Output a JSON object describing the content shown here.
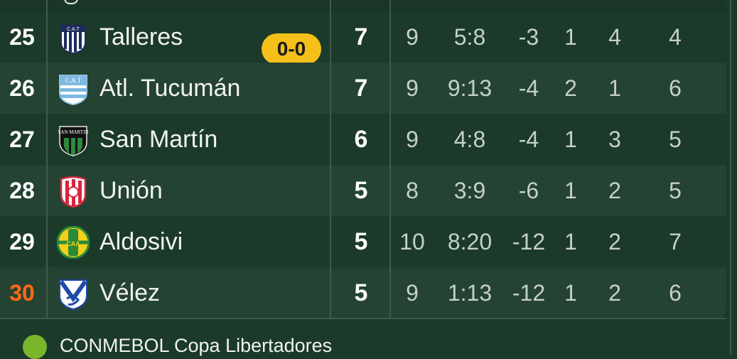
{
  "rows": [
    {
      "pos": "25",
      "team": "Talleres",
      "pts": "7",
      "played": "9",
      "goals": "5:8",
      "diff": "-3",
      "w": "1",
      "d": "4",
      "l": "4",
      "logo": "talleres-crest-icon"
    },
    {
      "pos": "26",
      "team": "Atl. Tucumán",
      "pts": "7",
      "played": "9",
      "goals": "9:13",
      "diff": "-4",
      "w": "2",
      "d": "1",
      "l": "6",
      "logo": "atletico-tucuman-crest-icon"
    },
    {
      "pos": "27",
      "team": "San Martín",
      "pts": "6",
      "played": "9",
      "goals": "4:8",
      "diff": "-4",
      "w": "1",
      "d": "3",
      "l": "5",
      "logo": "san-martin-crest-icon"
    },
    {
      "pos": "28",
      "team": "Unión",
      "pts": "5",
      "played": "8",
      "goals": "3:9",
      "diff": "-6",
      "w": "1",
      "d": "2",
      "l": "5",
      "logo": "union-crest-icon"
    },
    {
      "pos": "29",
      "team": "Aldosivi",
      "pts": "5",
      "played": "10",
      "goals": "8:20",
      "diff": "-12",
      "w": "1",
      "d": "2",
      "l": "7",
      "logo": "aldosivi-crest-icon"
    },
    {
      "pos": "30",
      "team": "Vélez",
      "pts": "5",
      "played": "9",
      "goals": "1:13",
      "diff": "-12",
      "w": "1",
      "d": "2",
      "l": "6",
      "logo": "velez-crest-icon"
    }
  ],
  "live_score": "0-0",
  "crest_texts": {
    "talleres": "C.A.T",
    "tucuman": "C.A.T",
    "sanmartin": "SAN MARTIN",
    "aldosivi": "CAA"
  },
  "legend": {
    "label": "CONMEBOL Copa Libertadores",
    "color": "#7bb52b"
  },
  "colors": {
    "background": "#1b3a2a",
    "row_alt": "#244333",
    "relegation": "#ff6a14",
    "live_badge": "#f4c019"
  }
}
